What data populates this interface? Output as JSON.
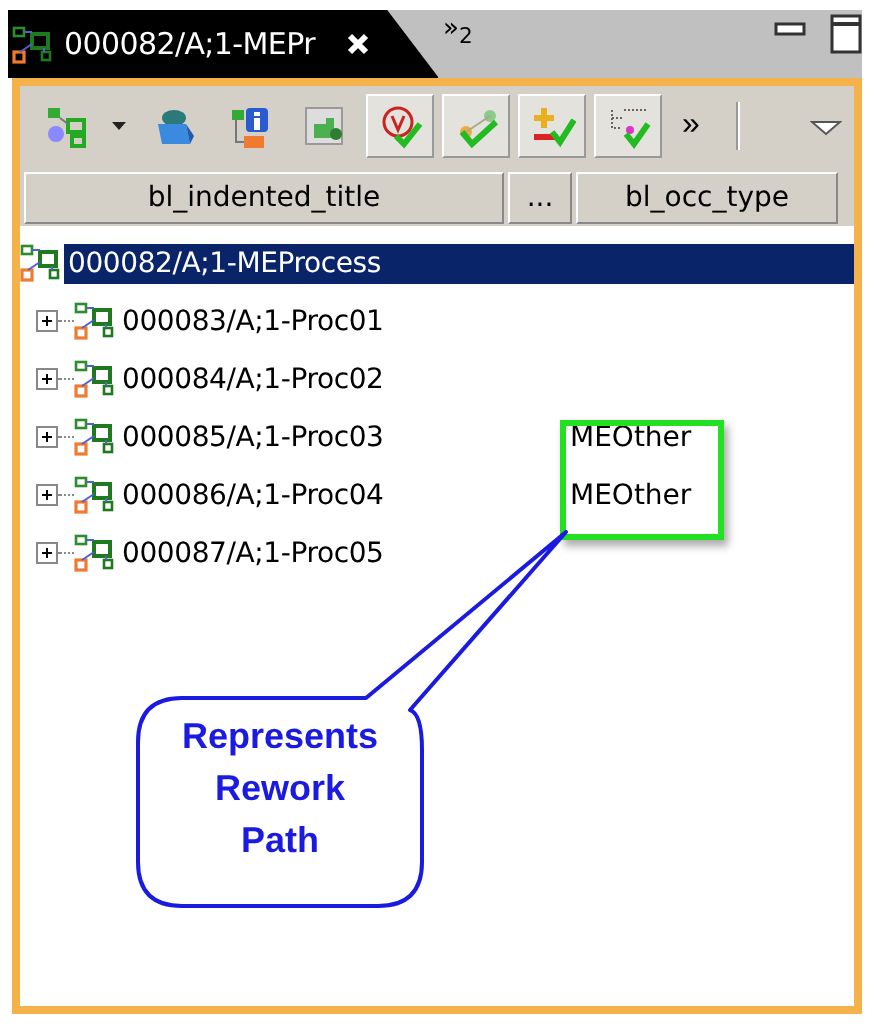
{
  "tab": {
    "title": "000082/A;1-MEPr",
    "selected": true
  },
  "overflow_tabs": "»$_{2}$",
  "toolbar": {
    "buttons": [
      {
        "kind": "structure",
        "pressed": false,
        "dropdown": true
      },
      {
        "kind": "cube",
        "pressed": false,
        "dropdown": false
      },
      {
        "kind": "info",
        "pressed": false,
        "dropdown": false
      },
      {
        "kind": "puzzle",
        "pressed": false,
        "dropdown": false
      },
      {
        "kind": "validate",
        "pressed": true,
        "dropdown": false
      },
      {
        "kind": "branch",
        "pressed": true,
        "dropdown": false
      },
      {
        "kind": "plusminus",
        "pressed": true,
        "dropdown": false
      },
      {
        "kind": "tree",
        "pressed": true,
        "dropdown": false
      }
    ],
    "more": "»"
  },
  "table": {
    "columns": [
      "bl_indented_title",
      "...",
      "bl_occ_type"
    ],
    "rows": [
      {
        "title": "000082/A;1-MEProcess",
        "selected": true,
        "children": [
          {
            "title": "000083/A;1-Proc01",
            "selected": false,
            "expanded": false
          },
          {
            "title": "000084/A;1-Proc02",
            "selected": false,
            "expanded": false
          },
          {
            "title": "000085/A;1-Proc03",
            "occ_type": "MEOther",
            "selected": false,
            "expanded": false
          },
          {
            "title": "000086/A;1-Proc04",
            "occ_type": "MEOther",
            "selected": false,
            "expanded": false
          },
          {
            "title": "000087/A;1-Proc05",
            "selected": false,
            "expanded": false
          }
        ]
      }
    ]
  },
  "callout": {
    "text": "Represents Rework Path"
  }
}
